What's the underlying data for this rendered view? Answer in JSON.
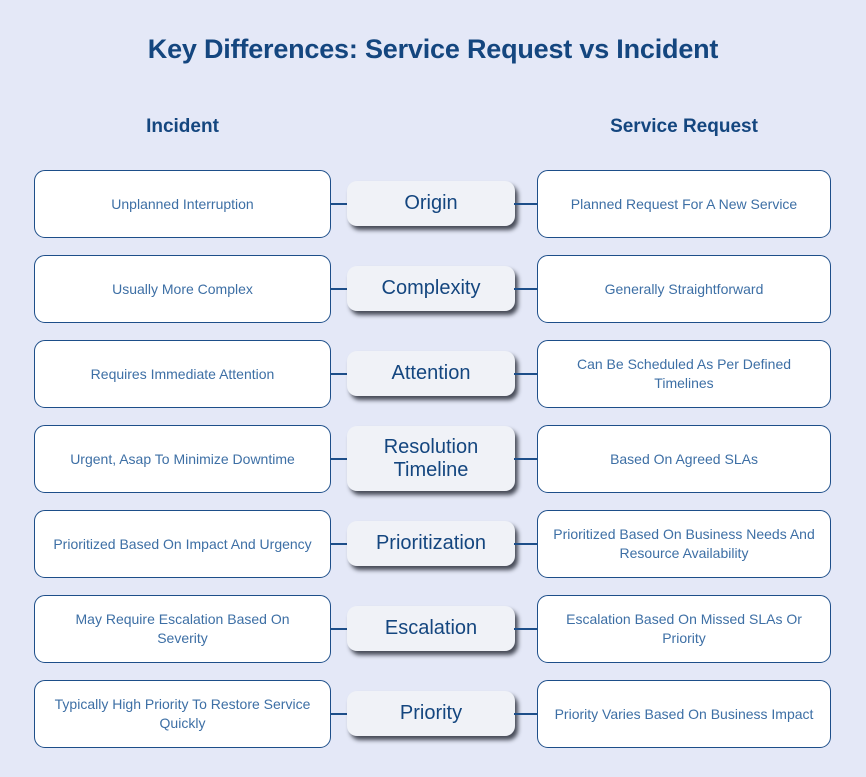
{
  "title": "Key Differences: Service Request vs Incident",
  "columns": {
    "left_header": "Incident",
    "right_header": "Service Request"
  },
  "colors": {
    "background": "#e4e8f7",
    "heading_navy": "#14467f",
    "body_blue": "#3d6fa5",
    "card_border": "#1d4e89",
    "card_fill": "#ffffff",
    "mid_card_fill": "#f0f2f7"
  },
  "rows": [
    {
      "attribute": "Origin",
      "incident": "Unplanned Interruption",
      "service_request": "Planned Request For A New Service",
      "two_line_label": false
    },
    {
      "attribute": "Complexity",
      "incident": "Usually More Complex",
      "service_request": "Generally Straightforward",
      "two_line_label": false
    },
    {
      "attribute": "Attention",
      "incident": "Requires Immediate Attention",
      "service_request": "Can Be Scheduled As Per Defined Timelines",
      "two_line_label": false
    },
    {
      "attribute": "Resolution Timeline",
      "incident": "Urgent, Asap To Minimize Downtime",
      "service_request": "Based On Agreed SLAs",
      "two_line_label": true
    },
    {
      "attribute": "Prioritization",
      "incident": "Prioritized Based On Impact And Urgency",
      "service_request": "Prioritized Based On Business Needs And Resource Availability",
      "two_line_label": false
    },
    {
      "attribute": "Escalation",
      "incident": "May Require Escalation Based On Severity",
      "service_request": "Escalation Based On Missed SLAs Or Priority",
      "two_line_label": false
    },
    {
      "attribute": "Priority",
      "incident": "Typically High Priority To Restore Service Quickly",
      "service_request": "Priority Varies Based On Business Impact",
      "two_line_label": false
    }
  ]
}
